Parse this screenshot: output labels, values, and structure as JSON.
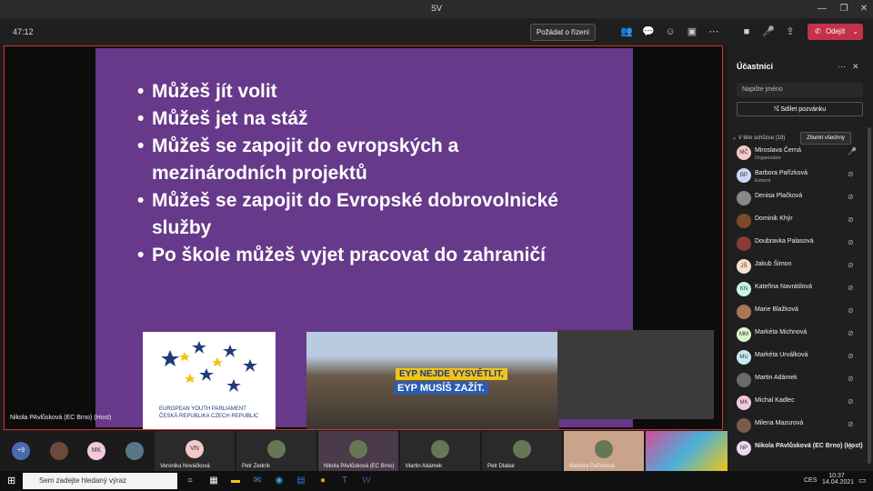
{
  "window": {
    "title": "SV"
  },
  "toolbar": {
    "timer": "47:12",
    "request_control": "Požádat o řízení",
    "leave": "Odejít",
    "icons": [
      "people-icon",
      "chat-icon",
      "reactions-icon",
      "rooms-icon",
      "more-icon",
      "camera-icon",
      "mic-icon",
      "share-icon"
    ]
  },
  "slide": {
    "bullets": [
      "Můžeš jít volit",
      "Můžeš jet na stáž",
      "Můžeš se zapojit do evropských a",
      "mezinárodních projektů",
      "Můžeš se zapojit do Evropské dobrovolnické",
      "služby",
      "Po škole můžeš vyjet pracovat do zahraničí"
    ],
    "logo": {
      "line1": "EUROPEAN YOUTH PARLIAMENT",
      "line2": "ČESKÁ REPUBLIKA CZECH REPUBLIC"
    },
    "banner1": "EYP NEJDE VYSVĚTLIT,",
    "banner2": "EYP MUSÍŠ ZAŽÍT."
  },
  "presenter_label": "Nikola PAvlůsková (EC Brno) (Host)",
  "panel": {
    "title": "Účastníci",
    "search_placeholder": "Napište jméno",
    "share": "Sdílet pozvánku",
    "section": "V této schůzce (19)",
    "mute_all": "Ztlumit všechny",
    "participants": [
      {
        "name": "Miroslava Černá",
        "role": "Organizátor",
        "initials": "MČ",
        "color": "#f4c9c9"
      },
      {
        "name": "Barbora Pařízková",
        "role": "Externí",
        "initials": "BP",
        "color": "#c9d9f4"
      },
      {
        "name": "Denisa Plačková",
        "role": "",
        "initials": "",
        "color": "#888"
      },
      {
        "name": "Dominik Khýr",
        "role": "",
        "initials": "",
        "color": "#7a4a2a"
      },
      {
        "name": "Doubravka Palasová",
        "role": "",
        "initials": "",
        "color": "#8a3a3a"
      },
      {
        "name": "Jakub Šimon",
        "role": "",
        "initials": "JŠ",
        "color": "#f4e0c9"
      },
      {
        "name": "Kateřina Navrátilová",
        "role": "",
        "initials": "KN",
        "color": "#c9f4e0"
      },
      {
        "name": "Marie Blažková",
        "role": "",
        "initials": "",
        "color": "#aa7755"
      },
      {
        "name": "Markéta Michnová",
        "role": "",
        "initials": "MM",
        "color": "#d9f4c9"
      },
      {
        "name": "Markéta Urválková",
        "role": "",
        "initials": "MU",
        "color": "#c9e9f4"
      },
      {
        "name": "Martin Adámek",
        "role": "",
        "initials": "",
        "color": "#6a6a6a"
      },
      {
        "name": "Michal Kadlec",
        "role": "",
        "initials": "MK",
        "color": "#f4c9e0"
      },
      {
        "name": "Milena Mazurová",
        "role": "",
        "initials": "",
        "color": "#7a5a4a"
      },
      {
        "name": "Nikola PAvlůsková (EC Brno) (Host)",
        "role": "",
        "initials": "NP",
        "color": "#e9d9f4"
      }
    ]
  },
  "gallery": {
    "more": "+9",
    "avatars": [
      "",
      "MK",
      ""
    ],
    "tiles": [
      {
        "name": "Veronika Nováčková",
        "initials": "VN"
      },
      {
        "name": "Petr Zedník",
        "initials": ""
      },
      {
        "name": "Nikola PAvlůsková (EC Brno)",
        "initials": ""
      },
      {
        "name": "Martin Adámek",
        "initials": ""
      },
      {
        "name": "Petr Dlabal",
        "initials": ""
      },
      {
        "name": "Barbora Pařízková",
        "initials": ""
      }
    ]
  },
  "taskbar": {
    "search_placeholder": "Sem zadejte hledaný výraz",
    "time": "10:37",
    "date": "14.04.2021",
    "lang": "CES"
  }
}
